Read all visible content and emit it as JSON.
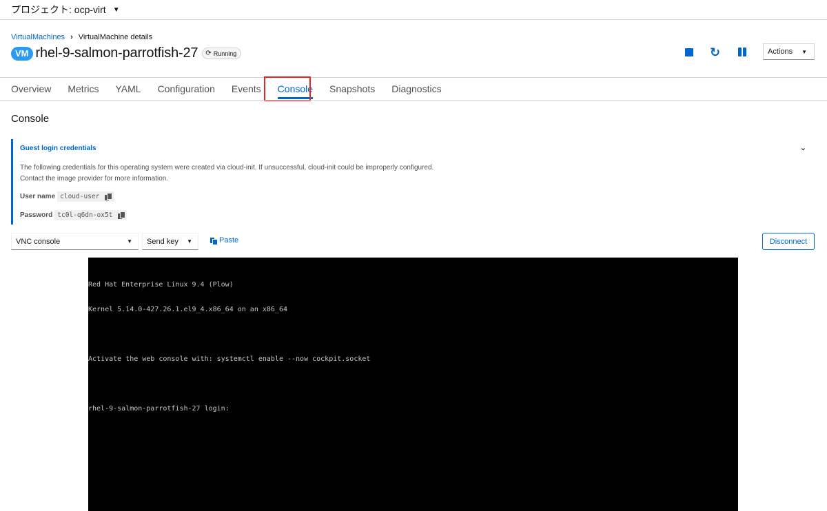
{
  "project_bar": {
    "label": "プロジェクト: ocp-virt"
  },
  "breadcrumb": {
    "parent": "VirtualMachines",
    "current": "VirtualMachine details"
  },
  "header": {
    "badge": "VM",
    "name": "rhel-9-salmon-parrotfish-27",
    "status": "Running",
    "actions_label": "Actions"
  },
  "tabs": [
    {
      "label": "Overview"
    },
    {
      "label": "Metrics"
    },
    {
      "label": "YAML"
    },
    {
      "label": "Configuration"
    },
    {
      "label": "Events"
    },
    {
      "label": "Console"
    },
    {
      "label": "Snapshots"
    },
    {
      "label": "Diagnostics"
    }
  ],
  "active_tab": "Console",
  "section_title": "Console",
  "credentials": {
    "title": "Guest login credentials",
    "desc_line1": "The following credentials for this operating system were created via cloud-init. If unsuccessful, cloud-init could be improperly configured.",
    "desc_line2": "Contact the image provider for more information.",
    "username_label": "User name",
    "username_value": "cloud-user",
    "password_label": "Password",
    "password_value": "tc0l-q6dn-ox5t"
  },
  "toolbar": {
    "console_type": "VNC console",
    "send_key": "Send key",
    "paste": "Paste",
    "disconnect": "Disconnect"
  },
  "terminal": {
    "lines": [
      "Red Hat Enterprise Linux 9.4 (Plow)",
      "Kernel 5.14.0-427.26.1.el9_4.x86_64 on an x86_64",
      "",
      "Activate the web console with: systemctl enable --now cockpit.socket",
      "",
      "rhel-9-salmon-parrotfish-27 login:"
    ]
  },
  "colors": {
    "accent": "#0066cc",
    "highlight": "#e8251b",
    "vm_badge": "#2b9af3",
    "terminal_bg": "#000000"
  }
}
